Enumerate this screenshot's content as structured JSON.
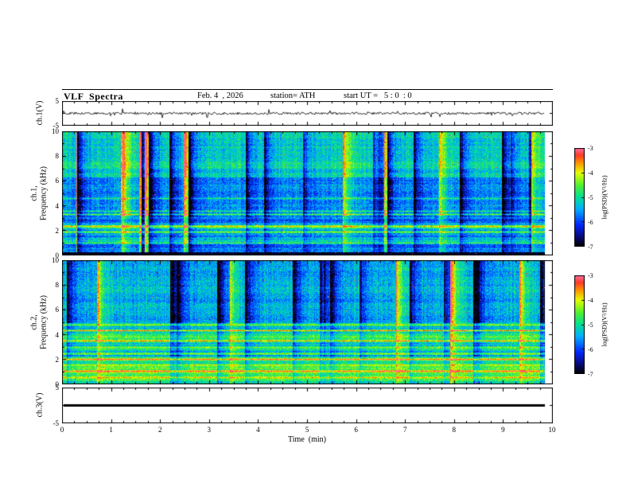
{
  "header": {
    "title": "VLF  Spectra",
    "date": "Feb. 4  , 2026",
    "station": "station= ATH",
    "start_ut": "start UT =   5 : 0  : 0"
  },
  "chart_data": [
    {
      "id": "ch1_waveform",
      "type": "line",
      "ylabel": "ch.1(V)",
      "ylim": [
        -5,
        5
      ],
      "yticks": [
        5,
        -5
      ],
      "xlim": [
        0,
        10
      ],
      "series": [
        {
          "name": "ch.1 voltage",
          "summary": "irregular noise oscillating around 0 V, mostly within ±1 V with frequent small spikes and occasional ±2-3 V impulses, data extends from 0 to about 9.8 min"
        }
      ]
    },
    {
      "id": "ch1_spectrogram",
      "type": "heatmap",
      "ylabel_line1": "ch.1,",
      "ylabel_line2": "Frequency (kHz)",
      "ylim": [
        0,
        10
      ],
      "yticks": [
        10,
        8,
        6,
        4,
        2,
        0
      ],
      "xlim": [
        0,
        10
      ],
      "colorbar": {
        "label": "log(PSD)(V²/Hz)",
        "ticks": [
          -3,
          -4,
          -5,
          -6,
          -7
        ],
        "range": [
          -7,
          -3
        ]
      },
      "summary": "broadband VLF noise: cyan-green speckle 6-10 kHz, darker blue band 3-6 kHz with dark-blue vertical streaks, bright horizontal emission lines near 1-3.6 kHz, near-black band below ~0.3 kHz, scattered yellow/red impulsive vertical streaks, data ends ~9.8 min"
    },
    {
      "id": "ch2_spectrogram",
      "type": "heatmap",
      "ylabel_line1": "ch.2,",
      "ylabel_line2": "Frequency (kHz)",
      "ylim": [
        0,
        10
      ],
      "yticks": [
        10,
        8,
        6,
        4,
        2,
        0
      ],
      "xlim": [
        0,
        10
      ],
      "colorbar": {
        "label": "log(PSD)(V²/Hz)",
        "ticks": [
          -3,
          -4,
          -5,
          -6,
          -7
        ],
        "range": [
          -7,
          -3
        ]
      },
      "summary": "similar broadband noise; strong yellow-green horizontal banding below ~5 kHz with bright lines near 2 and 4.3 kHz, blue/cyan streaky noise with dark vertical patches above 5 kHz, data ends ~9.8 min"
    },
    {
      "id": "ch3_waveform",
      "type": "line",
      "ylabel": "ch.3(V)",
      "ylim": [
        -5,
        5
      ],
      "yticks": [
        5,
        -5
      ],
      "xlim": [
        0,
        10
      ],
      "series": [
        {
          "name": "ch.3 voltage",
          "summary": "constant 0 V thick flat line from 0 to about 9.8 min"
        }
      ]
    }
  ],
  "xaxis": {
    "label": "Time  (min)",
    "ticks": [
      0,
      1,
      2,
      3,
      4,
      5,
      6,
      7,
      8,
      9,
      10
    ]
  }
}
